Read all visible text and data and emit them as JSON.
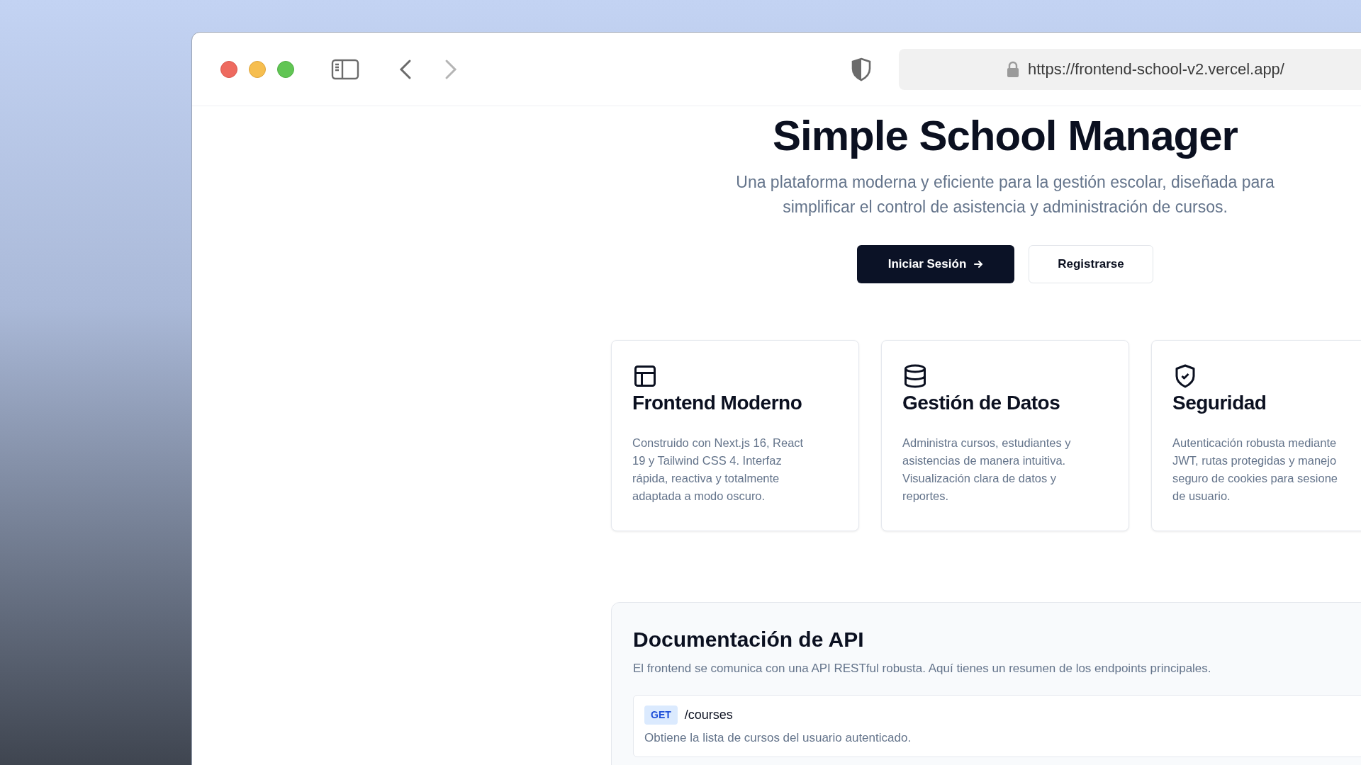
{
  "browser": {
    "url": "https://frontend-school-v2.vercel.app/"
  },
  "hero": {
    "title": "Simple School Manager",
    "subtitle": "Una plataforma moderna y eficiente para la gestión escolar, diseñada para simplificar el control de asistencia y administración de cursos.",
    "buttons": [
      {
        "label": "Iniciar Sesión",
        "kind": "primary"
      },
      {
        "label": "Registrarse",
        "kind": "outline"
      }
    ]
  },
  "features": [
    {
      "kind": "layout",
      "title": "Frontend Moderno",
      "description_lines": [
        "Construido con Next.js 16, React",
        "19 y Tailwind CSS 4. Interfaz",
        "rápida, reactiva y totalmente",
        "adaptada a modo oscuro."
      ]
    },
    {
      "kind": "database",
      "title": "Gestión de Datos",
      "description_lines": [
        "Administra cursos, estudiantes y",
        "asistencias de manera intuitiva.",
        "Visualización clara de datos y",
        "reportes."
      ]
    },
    {
      "kind": "shield",
      "title": "Seguridad",
      "description_lines": [
        "Autenticación robusta mediante",
        "JWT, rutas protegidas y manejo",
        "seguro de cookies para sesione",
        "de usuario."
      ]
    }
  ],
  "api_docs": {
    "title": "Documentación de API",
    "description": "El frontend se comunica con una API RESTful robusta. Aquí tienes un resumen de los endpoints principales.",
    "endpoints": [
      {
        "method": "GET",
        "path": "/courses",
        "description": "Obtiene la lista de cursos del usuario autenticado."
      }
    ]
  }
}
